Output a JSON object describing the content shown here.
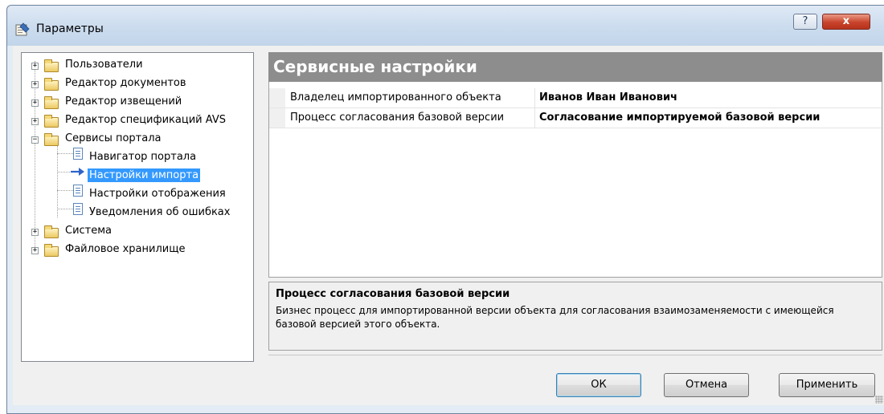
{
  "window": {
    "title": "Параметры",
    "help_glyph": "?",
    "close_glyph": "x"
  },
  "tree": {
    "items": [
      {
        "label": "Пользователи"
      },
      {
        "label": "Редактор документов"
      },
      {
        "label": "Редактор извещений"
      },
      {
        "label": "Редактор спецификаций AVS"
      },
      {
        "label": "Сервисы портала",
        "expanded": true
      },
      {
        "label": "Навигатор портала"
      },
      {
        "label": "Настройки импорта",
        "selected": true
      },
      {
        "label": "Настройки отображения"
      },
      {
        "label": "Уведомления об ошибках"
      },
      {
        "label": "Система"
      },
      {
        "label": "Файловое хранилище"
      }
    ],
    "expand_glyph": "+",
    "collapse_glyph": "−"
  },
  "section": {
    "title": "Сервисные настройки"
  },
  "properties": [
    {
      "name": "Владелец импортированного объекта",
      "value": "Иванов Иван Иванович"
    },
    {
      "name": "Процесс согласования базовой версии",
      "value": "Согласование импортируемой базовой версии"
    }
  ],
  "description": {
    "title": "Процесс согласования базовой версии",
    "text": "Бизнес процесс для импортированной версии объекта для согласования взаимозаменяемости с имеющейся базовой версией этого объекта."
  },
  "buttons": {
    "ok": "ОК",
    "cancel": "Отмена",
    "apply": "Применить"
  },
  "colors": {
    "section_header": "#8d8d8d",
    "selection": "#3399ff",
    "close_button": "#c8432b"
  }
}
